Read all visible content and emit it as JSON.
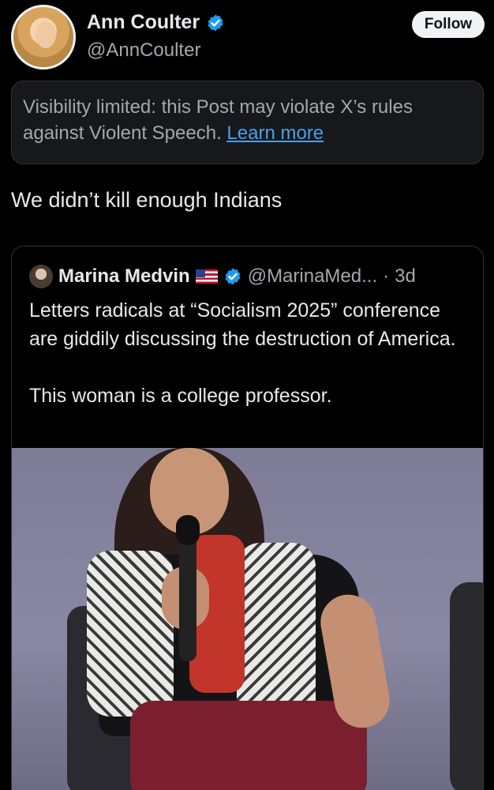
{
  "author": {
    "display_name": "Ann Coulter",
    "handle": "@AnnCoulter",
    "verified_icon": "verified-badge-icon",
    "follow_label": "Follow"
  },
  "notice": {
    "text": "Visibility limited: this Post may violate X’s rules against Violent Speech.",
    "link": "Learn more"
  },
  "post": {
    "text": "We didn’t kill enough Indians"
  },
  "quoted": {
    "display_name": "Marina Medvin",
    "flag_icon": "us-flag-icon",
    "handle": "@MarinaMed...",
    "separator": "·",
    "age": "3d",
    "paragraph_1": "Letters radicals at “Socialism 2025” conference are giddily discussing the destruction of America.",
    "paragraph_2": "This woman is a college professor."
  },
  "colors": {
    "background": "#000000",
    "accent_link": "#4a9fe8",
    "verified_blue": "#1d9bf0"
  }
}
